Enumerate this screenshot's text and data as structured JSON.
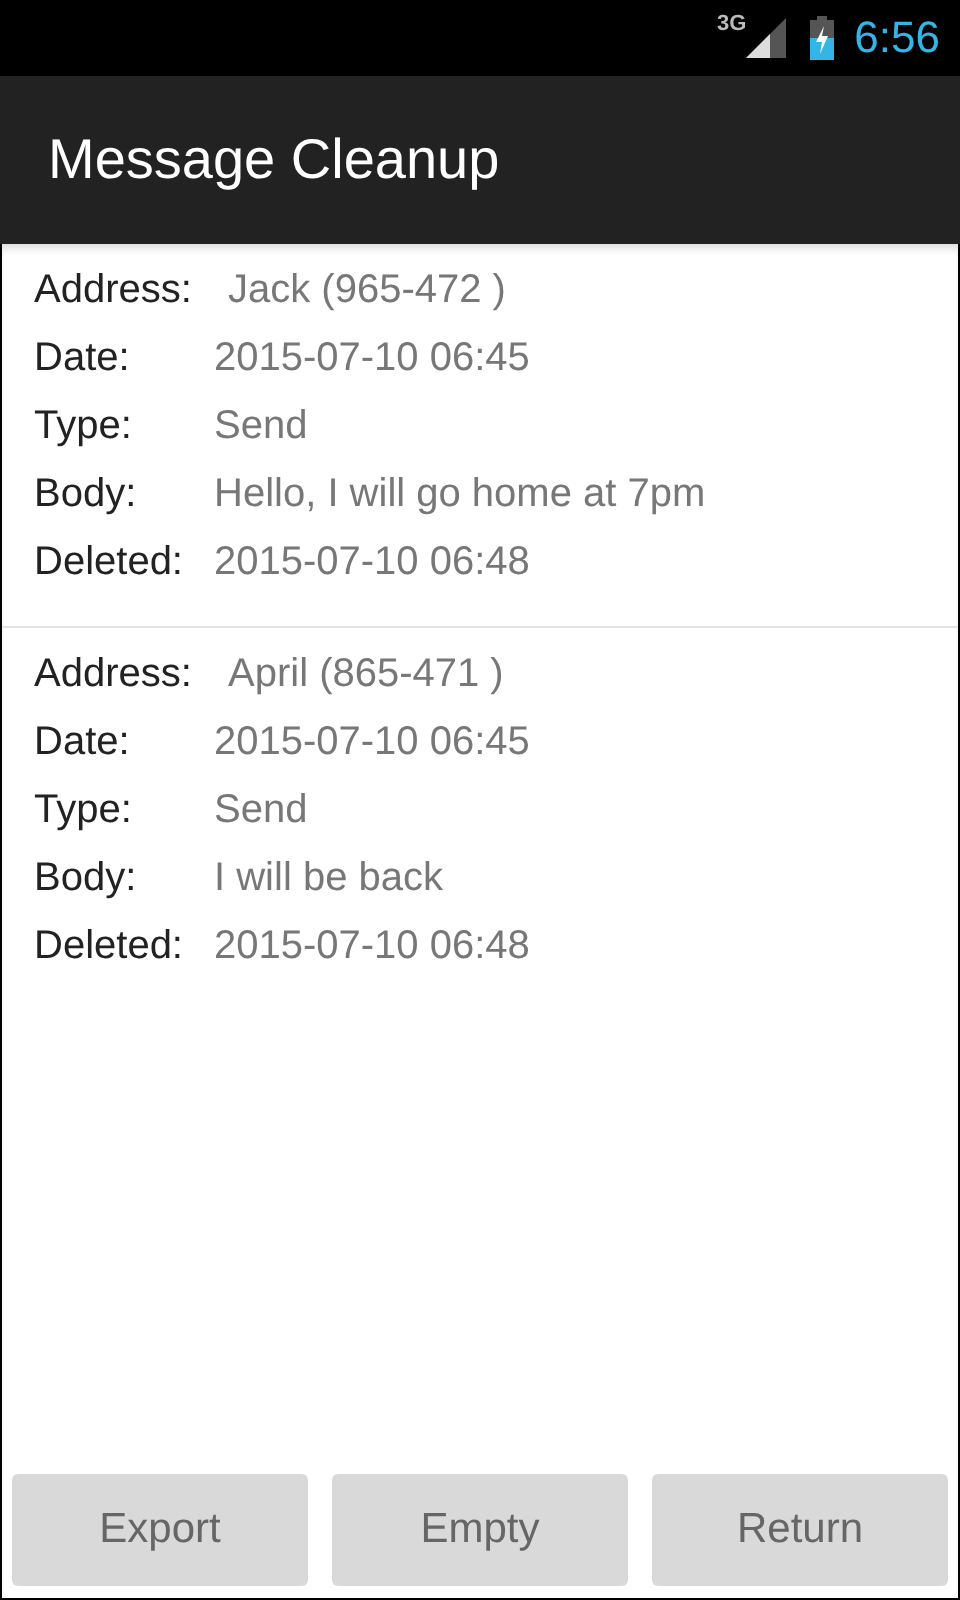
{
  "status_bar": {
    "network": "3G",
    "time": "6:56"
  },
  "action_bar": {
    "title": "Message Cleanup"
  },
  "messages": [
    {
      "fields": [
        {
          "label": "Address:",
          "value": "Jack (965-472 )"
        },
        {
          "label": "Date:",
          "value": "2015-07-10 06:45"
        },
        {
          "label": "Type:",
          "value": "Send"
        },
        {
          "label": "Body:",
          "value": "Hello, I will go home at 7pm"
        },
        {
          "label": "Deleted:",
          "value": "2015-07-10 06:48"
        }
      ]
    },
    {
      "fields": [
        {
          "label": "Address:",
          "value": "April (865-471 )"
        },
        {
          "label": "Date:",
          "value": "2015-07-10 06:45"
        },
        {
          "label": "Type:",
          "value": "Send"
        },
        {
          "label": "Body:",
          "value": "I will be back"
        },
        {
          "label": "Deleted:",
          "value": "2015-07-10 06:48"
        }
      ]
    }
  ],
  "buttons": [
    "Export",
    "Empty",
    "Return"
  ]
}
